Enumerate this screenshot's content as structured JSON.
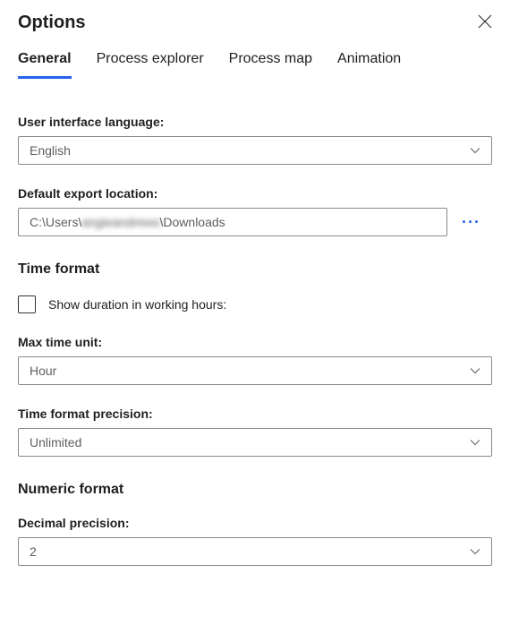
{
  "title": "Options",
  "tabs": {
    "general": "General",
    "processExplorer": "Process explorer",
    "processMap": "Process map",
    "animation": "Animation"
  },
  "fields": {
    "languageLabel": "User interface language:",
    "languageValue": "English",
    "exportLabel": "Default export location:",
    "exportValue": "C:\\Users\\",
    "exportValueBlurred": "angieandrews",
    "exportValueSuffix": "\\Downloads",
    "timeFormatTitle": "Time format",
    "showDurationLabel": "Show duration in working hours:",
    "maxTimeUnitLabel": "Max time unit:",
    "maxTimeUnitValue": "Hour",
    "timePrecisionLabel": "Time format precision:",
    "timePrecisionValue": "Unlimited",
    "numericFormatTitle": "Numeric format",
    "decimalPrecisionLabel": "Decimal precision:",
    "decimalPrecisionValue": "2"
  }
}
